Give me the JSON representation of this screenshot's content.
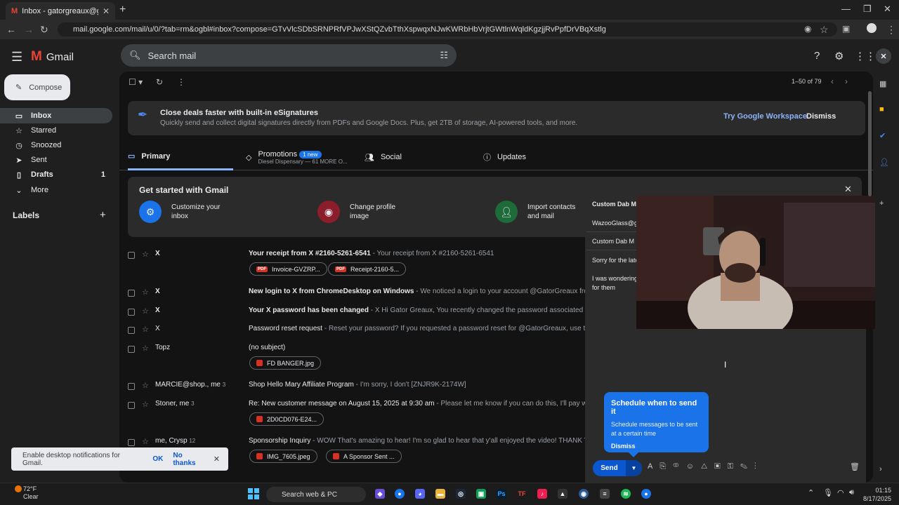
{
  "browser": {
    "tab_title": "Inbox - gatorgreaux@gmail.co",
    "url": "mail.google.com/mail/u/0/?tab=rm&ogbl#inbox?compose=GTvVlcSDbSRNPRfVPJwXStQZvbTthXspwqxNJwKWRbHbVrjtGWtlnWqldKgzjjRvPpfDrVBqXstlg"
  },
  "gmail": {
    "app_name": "Gmail",
    "search_placeholder": "Search mail",
    "compose_label": "Compose",
    "nav": [
      {
        "label": "Inbox",
        "count": ""
      },
      {
        "label": "Starred",
        "count": ""
      },
      {
        "label": "Snoozed",
        "count": ""
      },
      {
        "label": "Sent",
        "count": ""
      },
      {
        "label": "Drafts",
        "count": "1"
      },
      {
        "label": "More",
        "count": ""
      }
    ],
    "labels_heading": "Labels",
    "pager": "1–50 of 79",
    "banner": {
      "title": "Close deals faster with built-in eSignatures",
      "subtitle": "Quickly send and collect digital signatures directly from PDFs and Google Docs. Plus, get 2TB of storage, AI-powered tools, and more.",
      "cta": "Try Google Workspace",
      "dismiss": "Dismiss"
    },
    "tabs": {
      "primary": "Primary",
      "promotions": "Promotions",
      "promotions_badge": "1 new",
      "promotions_sub": "Diesel Dispensary — 61 MORE O...",
      "social": "Social",
      "updates": "Updates"
    },
    "get_started": {
      "title": "Get started with Gmail",
      "items": [
        {
          "label": "Customize your inbox"
        },
        {
          "label": "Change profile image"
        },
        {
          "label": "Import contacts and mail"
        }
      ]
    },
    "emails": [
      {
        "from": "X",
        "count": "",
        "subject": "Your receipt from X #2160-5261-6541",
        "snippet": " - Your receipt from X #2160-5261-6541",
        "attachments": [
          "Invoice-GVZRP...",
          "Receipt-2160-5..."
        ]
      },
      {
        "from": "X",
        "count": "",
        "subject": "New login to X from ChromeDesktop on Windows",
        "snippet": " - We noticed a login to your account @GatorGreaux from a n",
        "attachments": []
      },
      {
        "from": "X",
        "count": "",
        "subject": "Your X password has been changed",
        "snippet": " - X Hi Gator Greaux, You recently changed the password associated with yo",
        "attachments": []
      },
      {
        "from": "X",
        "count": "",
        "subject": "Password reset request",
        "snippet": " - Reset your password? If you requested a password reset for @GatorGreaux, use the co",
        "attachments": []
      },
      {
        "from": "Topz",
        "count": "",
        "subject": "(no subject)",
        "snippet": "",
        "attachments": [
          "FD BANGER.jpg"
        ]
      },
      {
        "from": "MARCIE@shop., me",
        "count": "3",
        "subject": "Shop Hello Mary Affiliate Program",
        "snippet": " - I'm sorry, I don't [ZNJR9K-2174W]",
        "attachments": []
      },
      {
        "from": "Stoner, me",
        "count": "3",
        "subject": "Re: New customer message on August 15, 2025 at 9:30 am",
        "snippet": " - Please let me know if you can do this, I'll pay whateve",
        "attachments": [
          "2D0CD076-E24..."
        ]
      },
      {
        "from": "me, Crysp",
        "count": "12",
        "subject": "Sponsorship Inquiry",
        "snippet": " - WOW That's amazing to hear! I'm so glad to hear that y'all enjoyed the video! THANK YOU S",
        "attachments": [
          "IMG_7605.jpeg",
          "A Sponsor Sent ..."
        ]
      }
    ],
    "compose_window": {
      "title": "Custom Dab M",
      "to": "WazooGlass@g",
      "subject": "Custom Dab M",
      "body_line1": "Sorry for the late",
      "body_line2": "I was wondering",
      "body_line3": "for them",
      "send_label": "Send",
      "schedule_tip": {
        "title": "Schedule when to send it",
        "body": "Schedule messages to be sent at a certain time",
        "dismiss": "Dismiss"
      }
    },
    "toast": {
      "text": "Enable desktop notifications for Gmail.",
      "ok": "OK",
      "no": "No thanks"
    }
  },
  "taskbar": {
    "weather_temp": "72°F",
    "weather_desc": "Clear",
    "search_label": "Search web & PC",
    "time": "01:15",
    "date": "8/17/2025"
  }
}
